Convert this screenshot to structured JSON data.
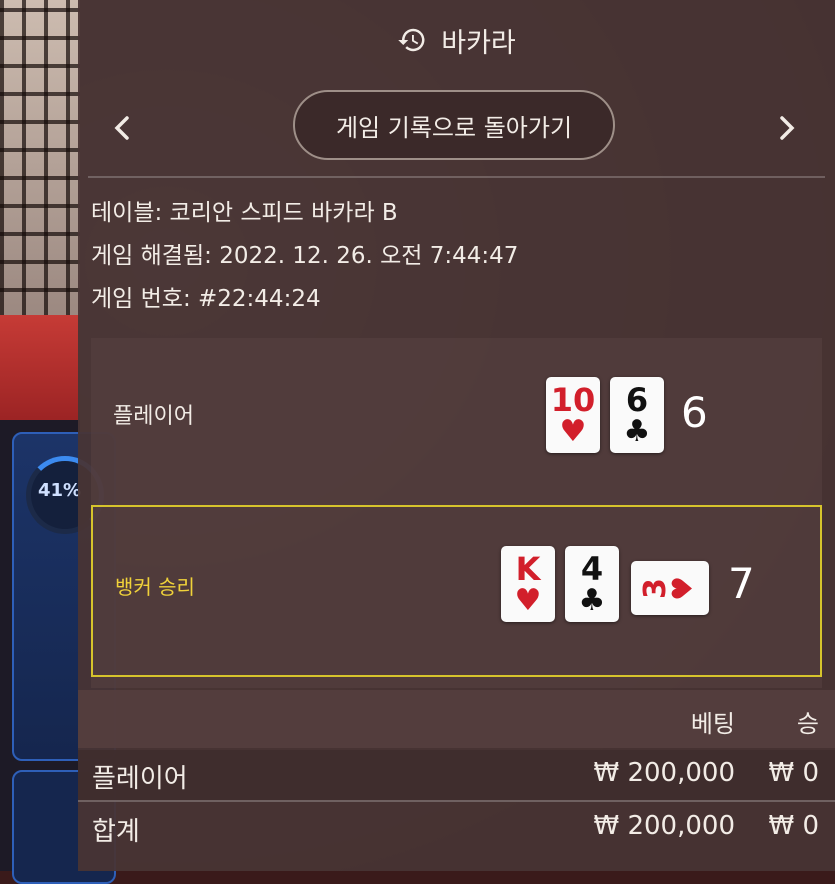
{
  "background": {
    "bet_percent": "41%"
  },
  "header": {
    "title": "바카라",
    "icon": "history-icon"
  },
  "nav": {
    "back_label": "게임 기록으로 돌아가기",
    "prev_icon": "‹",
    "next_icon": "›"
  },
  "info": {
    "table_label": "테이블:",
    "table_value": "코리안 스피드 바카라 B",
    "resolved_label": "게임 해결됨:",
    "resolved_value": "2022. 12. 26. 오전 7:44:47",
    "number_label": "게임 번호:",
    "number_value": "#22:44:24"
  },
  "result": {
    "player": {
      "label": "플레이어",
      "cards": [
        {
          "rank": "10",
          "suit": "♥",
          "color": "red"
        },
        {
          "rank": "6",
          "suit": "♣",
          "color": "black"
        }
      ],
      "score": "6"
    },
    "banker": {
      "label": "뱅커 승리",
      "cards": [
        {
          "rank": "K",
          "suit": "♥",
          "color": "red"
        },
        {
          "rank": "4",
          "suit": "♣",
          "color": "black"
        },
        {
          "rank": "3",
          "suit": "♥",
          "color": "red",
          "orientation": "horizontal"
        }
      ],
      "score": "7"
    }
  },
  "bets_table": {
    "headers": {
      "bet": "베팅",
      "win": "승"
    },
    "rows": [
      {
        "name": "플레이어",
        "bet": "₩ 200,000",
        "win": "₩ 0"
      }
    ],
    "total": {
      "name": "합계",
      "bet": "₩ 200,000",
      "win": "₩ 0"
    }
  },
  "colors": {
    "panel_bg": "#483434",
    "winner_border": "#d6c42c",
    "winner_text": "#f0d23a",
    "card_red": "#d21f2b"
  }
}
